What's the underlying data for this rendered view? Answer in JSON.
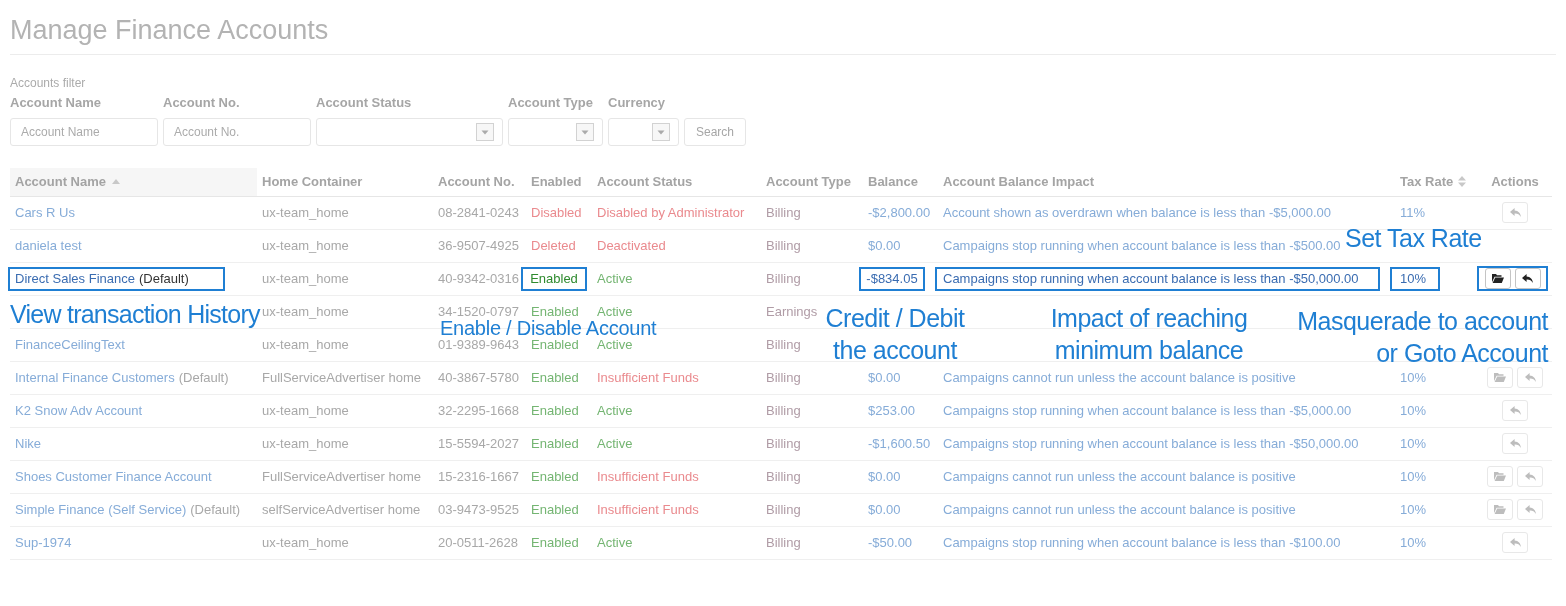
{
  "page": {
    "title": "Manage Finance Accounts"
  },
  "filter": {
    "heading": "Accounts filter",
    "fields": [
      {
        "kind": "text",
        "label": "Account Name",
        "placeholder": "Account Name"
      },
      {
        "kind": "text",
        "label": "Account No.",
        "placeholder": "Account No."
      },
      {
        "kind": "select",
        "label": "Account Status"
      },
      {
        "kind": "select",
        "label": "Account Type"
      },
      {
        "kind": "select",
        "label": "Currency"
      }
    ],
    "search_button": "Search"
  },
  "table": {
    "columns": [
      {
        "label": "Account Name",
        "kind": "sorted_ascending"
      },
      {
        "label": "Home Container",
        "kind": "plain"
      },
      {
        "label": "Account No.",
        "kind": "plain"
      },
      {
        "label": "Enabled",
        "kind": "plain"
      },
      {
        "label": "Account Status",
        "kind": "plain"
      },
      {
        "label": "Account Type",
        "kind": "plain"
      },
      {
        "label": "Balance",
        "kind": "plain"
      },
      {
        "label": "Account Balance Impact",
        "kind": "plain"
      },
      {
        "label": "Tax Rate",
        "kind": "sortable"
      },
      {
        "label": "Actions",
        "kind": "plain"
      }
    ],
    "rows": [
      {
        "name": "Cars R Us",
        "home_container": "ux-team_home",
        "account_no": "08-2841-0243",
        "enabled": false,
        "enabled_label": "Disabled",
        "status": "Disabled by Administrator",
        "status_ok": false,
        "account_type": "Billing",
        "balance": "-$2,800.00",
        "impact": "Account shown as overdrawn when balance is less than -$5,000.00",
        "tax_rate": "11%",
        "actions": [
          {
            "kind": "reply"
          }
        ],
        "highlighted": false
      },
      {
        "name": "daniela test",
        "home_container": "ux-team_home",
        "account_no": "36-9507-4925",
        "enabled": false,
        "enabled_label": "Deleted",
        "status": "Deactivated",
        "status_ok": false,
        "account_type": "Billing",
        "balance": "$0.00",
        "impact": "Campaigns stop running when account balance is less than -$500.00",
        "highlighted": false
      },
      {
        "name": "Direct Sales Finance",
        "default_tag": "(Default)",
        "home_container": "ux-team_home",
        "account_no": "40-9342-0316",
        "enabled": true,
        "enabled_label": "Enabled",
        "status": "Active",
        "status_ok": true,
        "account_type": "Billing",
        "balance": "-$834.05",
        "impact": "Campaigns stop running when account balance is less than -$50,000.00",
        "tax_rate": "10%",
        "actions": [
          {
            "kind": "folder"
          },
          {
            "kind": "reply"
          }
        ],
        "highlighted": true
      },
      {
        "home_container": "ux-team_home",
        "account_no": "34-1520-0797",
        "enabled": true,
        "enabled_label": "Enabled",
        "status": "Active",
        "status_ok": true,
        "account_type": "Earnings",
        "highlighted": false
      },
      {
        "name": "FinanceCeilingText",
        "home_container": "ux-team_home",
        "account_no": "01-9389-9643",
        "enabled": true,
        "enabled_label": "Enabled",
        "status": "Active",
        "status_ok": true,
        "account_type": "Billing",
        "highlighted": false
      },
      {
        "name": "Internal Finance Customers",
        "default_tag": "(Default)",
        "home_container": "FullServiceAdvertiser home",
        "account_no": "40-3867-5780",
        "enabled": true,
        "enabled_label": "Enabled",
        "status": "Insufficient Funds",
        "status_ok": false,
        "account_type": "Billing",
        "balance": "$0.00",
        "impact": "Campaigns cannot run unless the account balance is positive",
        "tax_rate": "10%",
        "actions": [
          {
            "kind": "folder"
          },
          {
            "kind": "reply"
          }
        ],
        "highlighted": false
      },
      {
        "name": "K2 Snow Adv Account",
        "home_container": "ux-team_home",
        "account_no": "32-2295-1668",
        "enabled": true,
        "enabled_label": "Enabled",
        "status": "Active",
        "status_ok": true,
        "account_type": "Billing",
        "balance": "$253.00",
        "impact": "Campaigns stop running when account balance is less than -$5,000.00",
        "tax_rate": "10%",
        "actions": [
          {
            "kind": "reply"
          }
        ],
        "highlighted": false
      },
      {
        "name": "Nike",
        "home_container": "ux-team_home",
        "account_no": "15-5594-2027",
        "enabled": true,
        "enabled_label": "Enabled",
        "status": "Active",
        "status_ok": true,
        "account_type": "Billing",
        "balance": "-$1,600.50",
        "impact": "Campaigns stop running when account balance is less than -$50,000.00",
        "tax_rate": "10%",
        "actions": [
          {
            "kind": "reply"
          }
        ],
        "highlighted": false
      },
      {
        "name": "Shoes Customer Finance Account",
        "home_container": "FullServiceAdvertiser home",
        "account_no": "15-2316-1667",
        "enabled": true,
        "enabled_label": "Enabled",
        "status": "Insufficient Funds",
        "status_ok": false,
        "account_type": "Billing",
        "balance": "$0.00",
        "impact": "Campaigns cannot run unless the account balance is positive",
        "tax_rate": "10%",
        "actions": [
          {
            "kind": "folder"
          },
          {
            "kind": "reply"
          }
        ],
        "highlighted": false
      },
      {
        "name": "Simple Finance (Self Service)",
        "default_tag": "(Default)",
        "home_container": "selfServiceAdvertiser home",
        "account_no": "03-9473-9525",
        "enabled": true,
        "enabled_label": "Enabled",
        "status": "Insufficient Funds",
        "status_ok": false,
        "account_type": "Billing",
        "balance": "$0.00",
        "impact": "Campaigns cannot run unless the account balance is positive",
        "tax_rate": "10%",
        "actions": [
          {
            "kind": "folder"
          },
          {
            "kind": "reply"
          }
        ],
        "highlighted": false
      },
      {
        "name": "Sup-1974",
        "home_container": "ux-team_home",
        "account_no": "20-0511-2628",
        "enabled": true,
        "enabled_label": "Enabled",
        "status": "Active",
        "status_ok": true,
        "account_type": "Billing",
        "balance": "-$50.00",
        "impact": "Campaigns stop running when account balance is less than -$100.00",
        "tax_rate": "10%",
        "actions": [
          {
            "kind": "reply"
          }
        ],
        "highlighted": false
      }
    ]
  },
  "annotations": [
    "Set Tax Rate",
    "View transaction History",
    "Enable / Disable Account",
    "Credit / Debit the account",
    "Impact of reaching minimum balance",
    "Masquerade to account or Goto Account"
  ]
}
